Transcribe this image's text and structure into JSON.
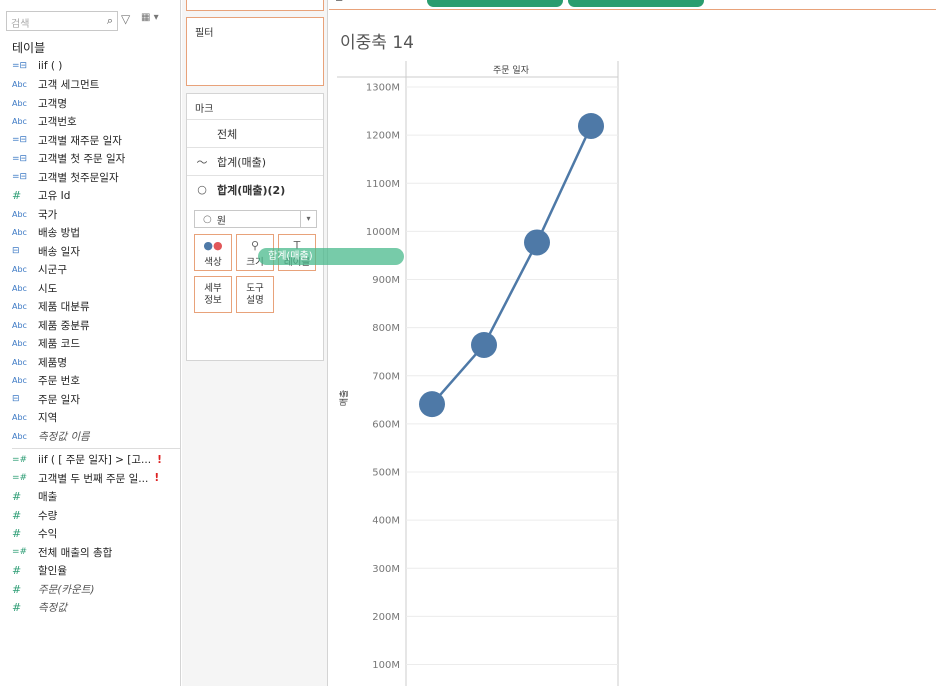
{
  "sidebar": {
    "search_placeholder": "검색",
    "section_title": "테이블",
    "fields": [
      {
        "icon": "calc",
        "label": "iif ( )",
        "italic": false
      },
      {
        "icon": "abc",
        "label": "고객 세그먼트",
        "italic": false
      },
      {
        "icon": "abc",
        "label": "고객명",
        "italic": false
      },
      {
        "icon": "abc",
        "label": "고객번호",
        "italic": false
      },
      {
        "icon": "calc",
        "label": "고객별 재주문 일자",
        "italic": false
      },
      {
        "icon": "calc",
        "label": "고객별 첫 주문 일자",
        "italic": false
      },
      {
        "icon": "calc",
        "label": "고객별 첫주문일자",
        "italic": false
      },
      {
        "icon": "hash",
        "label": "고유 Id",
        "italic": false
      },
      {
        "icon": "abc",
        "label": "국가",
        "italic": false
      },
      {
        "icon": "abc",
        "label": "배송 방법",
        "italic": false
      },
      {
        "icon": "cal",
        "label": "배송 일자",
        "italic": false
      },
      {
        "icon": "abc",
        "label": "시군구",
        "italic": false
      },
      {
        "icon": "abc",
        "label": "시도",
        "italic": false
      },
      {
        "icon": "abc",
        "label": "제품 대분류",
        "italic": false
      },
      {
        "icon": "abc",
        "label": "제품 중분류",
        "italic": false
      },
      {
        "icon": "abc",
        "label": "제품 코드",
        "italic": false
      },
      {
        "icon": "abc",
        "label": "제품명",
        "italic": false
      },
      {
        "icon": "abc",
        "label": "주문 번호",
        "italic": false
      },
      {
        "icon": "cal",
        "label": "주문 일자",
        "italic": false
      },
      {
        "icon": "abc",
        "label": "지역",
        "italic": false
      },
      {
        "icon": "abc",
        "label": "측정값 이름",
        "italic": true
      }
    ],
    "measures": [
      {
        "icon": "calcg",
        "label": "iif ( [ 주문 일자] > [고...",
        "italic": false,
        "warn": "!"
      },
      {
        "icon": "calcg",
        "label": "고객별 두 번째 주문 일...",
        "italic": false,
        "warn": "!"
      },
      {
        "icon": "hash",
        "label": "매출",
        "italic": false,
        "warn": ""
      },
      {
        "icon": "hash",
        "label": "수량",
        "italic": false,
        "warn": ""
      },
      {
        "icon": "hash",
        "label": "수익",
        "italic": false,
        "warn": ""
      },
      {
        "icon": "calcg",
        "label": "전체 매출의 총합",
        "italic": false,
        "warn": ""
      },
      {
        "icon": "hash",
        "label": "할인율",
        "italic": false,
        "warn": ""
      },
      {
        "icon": "hash",
        "label": "주문(카운트)",
        "italic": true,
        "warn": ""
      },
      {
        "icon": "hash",
        "label": "측정값",
        "italic": true,
        "warn": ""
      }
    ]
  },
  "filters": {
    "title": "필터"
  },
  "marks": {
    "title": "마크",
    "all_label": "전체",
    "line_label": "합계(매출)",
    "circle_label": "합계(매출)(2)",
    "type_value": "원",
    "buttons": {
      "color": "색상",
      "size": "크기",
      "label": "레이블",
      "detail": "세부\n정보",
      "tooltip": "도구\n설명"
    }
  },
  "drag_pill": "합계(매출)",
  "sheet_title": "이중축 14",
  "chart_data": {
    "type": "line",
    "xlabel": "주문 일자",
    "ylabel": "매출",
    "ylim": [
      0,
      1300
    ],
    "yticks": [
      "100M",
      "200M",
      "300M",
      "400M",
      "500M",
      "600M",
      "700M",
      "800M",
      "900M",
      "1000M",
      "1100M",
      "1200M",
      "1300M"
    ],
    "ytick_values": [
      100,
      200,
      300,
      400,
      500,
      600,
      700,
      800,
      900,
      1000,
      1100,
      1200,
      1300
    ],
    "series": [
      {
        "values": [
          641,
          764,
          977,
          1219
        ]
      }
    ],
    "line_color": "#4e79a7",
    "marker_color": "#4e79a7"
  }
}
